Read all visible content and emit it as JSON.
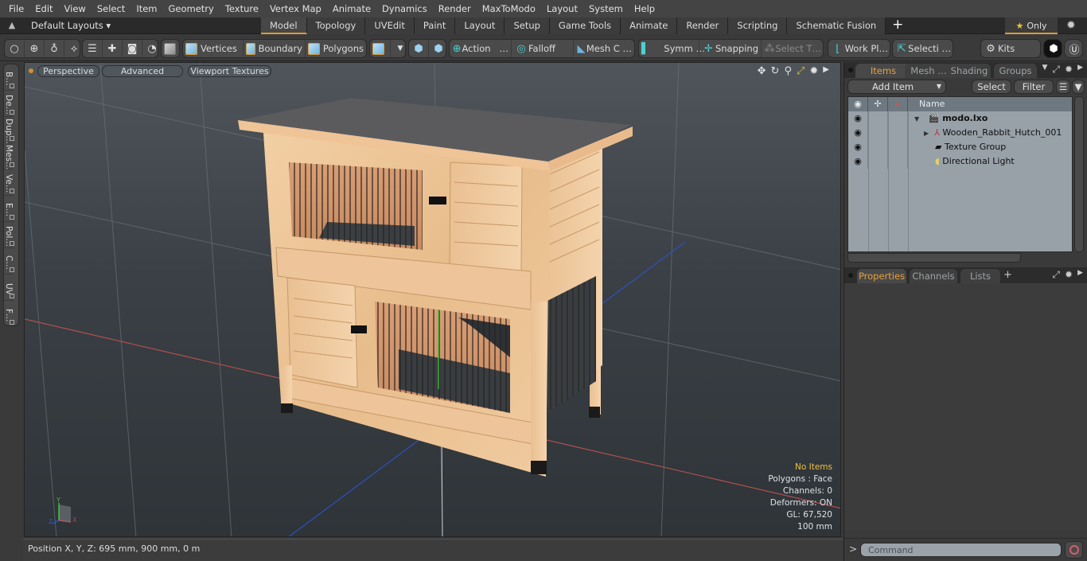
{
  "menubar": {
    "items": [
      "File",
      "Edit",
      "View",
      "Select",
      "Item",
      "Geometry",
      "Texture",
      "Vertex Map",
      "Animate",
      "Dynamics",
      "Render",
      "MaxToModo",
      "Layout",
      "System",
      "Help"
    ]
  },
  "layoutbar": {
    "layouts_label": "Default Layouts ▾",
    "tabs": [
      "Model",
      "Topology",
      "UVEdit",
      "Paint",
      "Layout",
      "Setup",
      "Game Tools",
      "Animate",
      "Render",
      "Scripting",
      "Schematic Fusion"
    ],
    "active_tab": "Model",
    "add_tab": "+",
    "only_label": "Only"
  },
  "toolbar": {
    "vertices": "Vertices",
    "boundary": "Boundary",
    "polygons": "Polygons",
    "action": "Action",
    "action_more": "…",
    "falloff": "Falloff",
    "mesh_c": "Mesh C …",
    "symm": "Symm …",
    "snapping": "Snapping",
    "select_t": "Select T…",
    "work_pl": "Work Pl…",
    "selecti": "Selecti …",
    "kits": "Kits"
  },
  "leftstrip": {
    "items": [
      "B…",
      "De…",
      "Dup…",
      "Mes…",
      "Ve…",
      "E…",
      "Pol…",
      "C…",
      "UV",
      "F…"
    ]
  },
  "viewport": {
    "view_mode": "Perspective",
    "shading": "Advanced",
    "textures": "Viewport Textures",
    "hud": {
      "selection": "No Items",
      "polygons": "Polygons : Face",
      "channels": "Channels: 0",
      "deformers": "Deformers: ON",
      "gl": "GL: 67,520",
      "scale": "100 mm"
    },
    "axis_labels": {
      "x": "X",
      "y": "Y",
      "z": "Z"
    }
  },
  "statusbar": {
    "position": "Position X, Y, Z:   695 mm, 900 mm, 0 m"
  },
  "items_panel": {
    "tabs": [
      "Items",
      "Mesh …",
      "Shading",
      "Groups"
    ],
    "active_tab": "Items",
    "add_item": "Add Item",
    "select": "Select",
    "filter": "Filter",
    "column_name": "Name",
    "tree": [
      {
        "name": "modo.lxo",
        "level": 0,
        "expander": "▼",
        "icon": "scene-icon",
        "bold": true
      },
      {
        "name": "Wooden_Rabbit_Hutch_001",
        "level": 1,
        "expander": "▶",
        "icon": "mesh-locator-icon",
        "bold": false
      },
      {
        "name": "Texture Group",
        "level": 1,
        "expander": "",
        "icon": "texture-group-icon",
        "bold": false
      },
      {
        "name": "Directional Light",
        "level": 1,
        "expander": "",
        "icon": "light-icon",
        "bold": false
      }
    ]
  },
  "properties_panel": {
    "tabs": [
      "Properties",
      "Channels",
      "Lists"
    ],
    "active_tab": "Properties",
    "add_tab": "+"
  },
  "command": {
    "prompt": ">",
    "placeholder": "Command"
  },
  "colors": {
    "accent": "#e09a3a",
    "hud_highlight": "#f0c040",
    "x_axis": "#c0504d",
    "y_axis": "#40c040",
    "z_axis": "#3050d0"
  }
}
